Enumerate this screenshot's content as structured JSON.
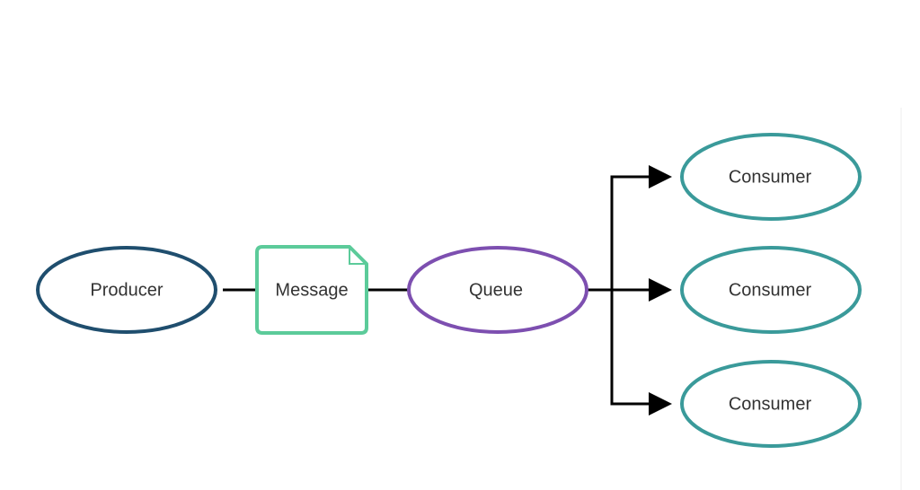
{
  "diagram": {
    "title": "",
    "nodes": [
      {
        "id": "producer",
        "label": "Producer",
        "shape": "ellipse",
        "color": "#1f4e6e"
      },
      {
        "id": "message",
        "label": "Message",
        "shape": "document",
        "color": "#5ccb9a"
      },
      {
        "id": "queue",
        "label": "Queue",
        "shape": "ellipse",
        "color": "#7d4fb0"
      },
      {
        "id": "consumer1",
        "label": "Consumer",
        "shape": "ellipse",
        "color": "#3a9a9a"
      },
      {
        "id": "consumer2",
        "label": "Consumer",
        "shape": "ellipse",
        "color": "#3a9a9a"
      },
      {
        "id": "consumer3",
        "label": "Consumer",
        "shape": "ellipse",
        "color": "#3a9a9a"
      }
    ],
    "edges": [
      {
        "from": "producer",
        "to": "message",
        "arrow": false
      },
      {
        "from": "message",
        "to": "queue",
        "arrow": false
      },
      {
        "from": "queue",
        "to": "consumer1",
        "arrow": true
      },
      {
        "from": "queue",
        "to": "consumer2",
        "arrow": true
      },
      {
        "from": "queue",
        "to": "consumer3",
        "arrow": true
      }
    ],
    "edge_color": "#000000"
  }
}
